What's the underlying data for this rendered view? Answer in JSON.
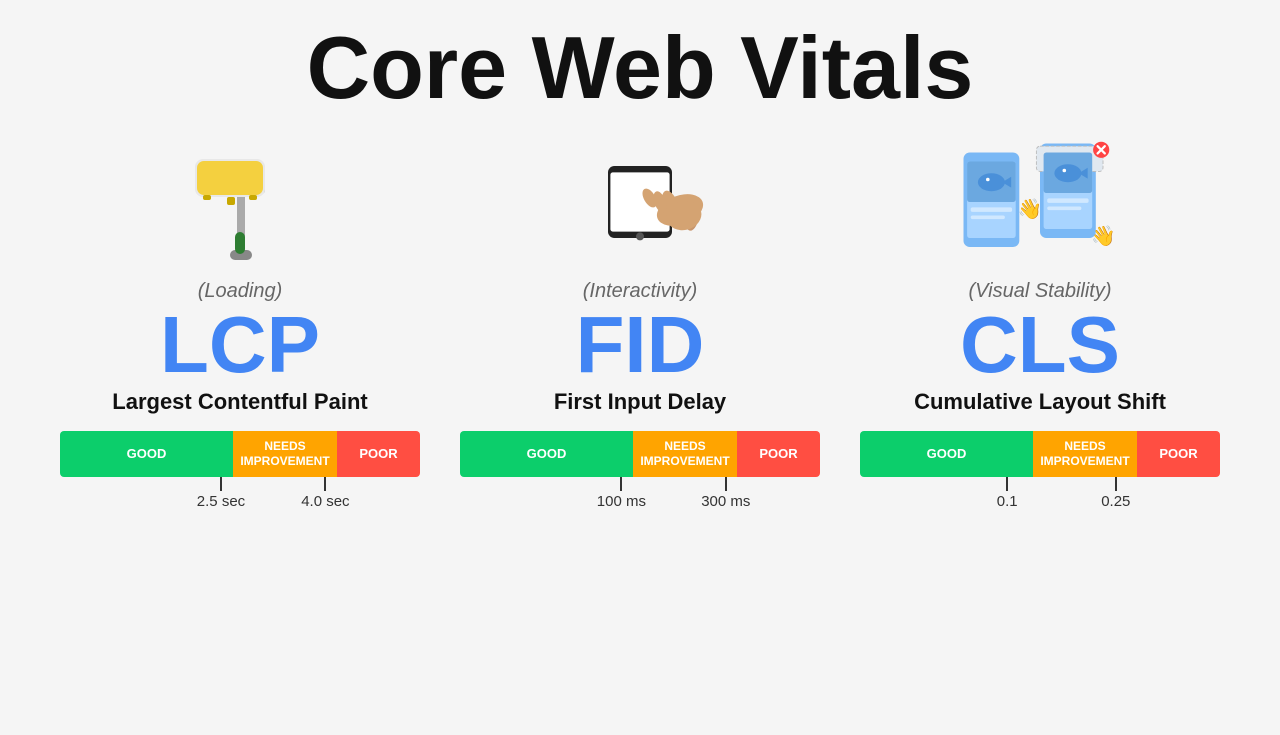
{
  "title": "Core Web Vitals",
  "metrics": [
    {
      "id": "lcp",
      "category": "(Loading)",
      "abbr": "LCP",
      "name": "Largest Contentful Paint",
      "bar": {
        "good": "GOOD",
        "needs": "NEEDS IMPROVEMENT",
        "poor": "POOR"
      },
      "thresholds": [
        {
          "value": "2.5 sec",
          "position": "38%"
        },
        {
          "value": "4.0 sec",
          "position": "67%"
        }
      ]
    },
    {
      "id": "fid",
      "category": "(Interactivity)",
      "abbr": "FID",
      "name": "First Input Delay",
      "bar": {
        "good": "GOOD",
        "needs": "NEEDS IMPROVEMENT",
        "poor": "POOR"
      },
      "thresholds": [
        {
          "value": "100 ms",
          "position": "38%"
        },
        {
          "value": "300 ms",
          "position": "67%"
        }
      ]
    },
    {
      "id": "cls",
      "category": "(Visual Stability)",
      "abbr": "CLS",
      "name": "Cumulative Layout Shift",
      "bar": {
        "good": "GOOD",
        "needs": "NEEDS IMPROVEMENT",
        "poor": "POOR"
      },
      "thresholds": [
        {
          "value": "0.1",
          "position": "38%"
        },
        {
          "value": "0.25",
          "position": "67%"
        }
      ]
    }
  ]
}
